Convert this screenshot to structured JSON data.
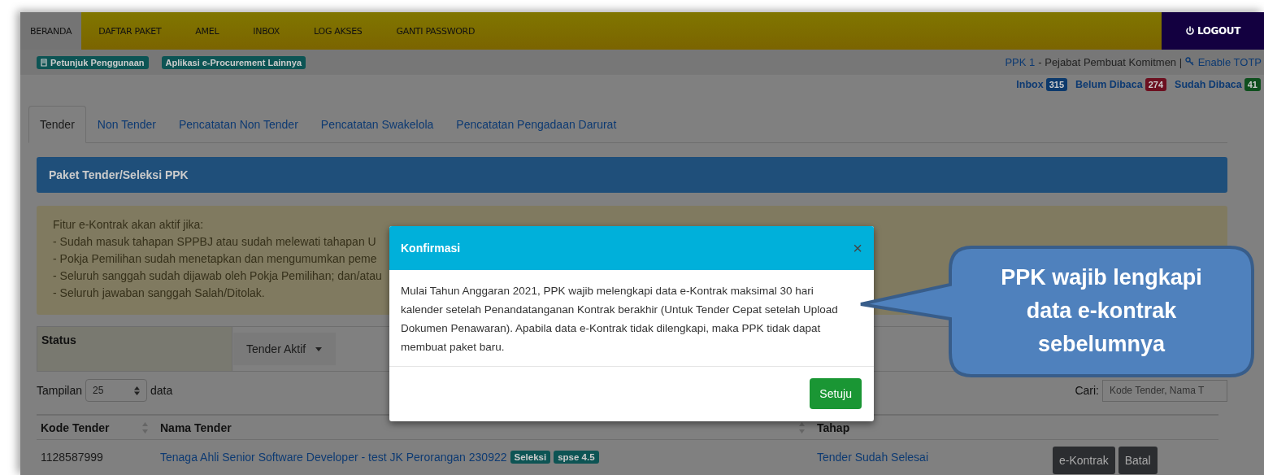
{
  "nav": {
    "items": [
      {
        "label": "BERANDA",
        "selected": true
      },
      {
        "label": "DAFTAR PAKET",
        "selected": false
      },
      {
        "label": "AMEL",
        "selected": false
      },
      {
        "label": "INBOX",
        "selected": false
      },
      {
        "label": "LOG AKSES",
        "selected": false
      },
      {
        "label": "GANTI PASSWORD",
        "selected": false
      }
    ],
    "logout": "LOGOUT"
  },
  "subbar": {
    "links": [
      "Petunjuk Penggunaan",
      "Aplikasi e-Procurement Lainnya"
    ],
    "user": {
      "name": "PPK 1",
      "role": "- Pejabat Pembuat Komitmen |",
      "totp": "Enable TOTP"
    },
    "counters": [
      {
        "label": "Inbox",
        "count": "315",
        "color": "#0d3a6c"
      },
      {
        "label": "Belum Dibaca",
        "count": "274",
        "color": "#6c1020"
      },
      {
        "label": "Sudah Dibaca",
        "count": "41",
        "color": "#0f4f1e"
      }
    ]
  },
  "tabs": [
    {
      "label": "Tender",
      "selected": true
    },
    {
      "label": "Non Tender",
      "selected": false
    },
    {
      "label": "Pencatatan Non Tender",
      "selected": false
    },
    {
      "label": "Pencatatan Swakelola",
      "selected": false
    },
    {
      "label": "Pencatatan Pengadaan Darurat",
      "selected": false
    }
  ],
  "panel": {
    "title": "Paket Tender/Seleksi PPK",
    "notice": [
      "Fitur e-Kontrak akan aktif jika:",
      "- Sudah masuk tahapan SPPBJ atau sudah melewati tahapan U",
      "- Pokja Pemilihan sudah menetapkan dan mengumumkan peme",
      "- Seluruh sanggah sudah dijawab oleh Pokja Pemilihan; dan/atau",
      "- Seluruh jawaban sanggah Salah/Ditolak."
    ],
    "status": {
      "label": "Status",
      "value": "Tender Aktif"
    },
    "page_size": {
      "label": "Tampilan",
      "value": "25",
      "suffix": "data"
    },
    "search": {
      "label": "Cari:",
      "placeholder": "Kode Tender, Nama T"
    },
    "table": {
      "columns": [
        {
          "label": "Kode Tender",
          "sortable": true
        },
        {
          "label": "Nama Tender",
          "sortable": true
        },
        {
          "label": "Tahap",
          "sortable": false
        }
      ],
      "rows": [
        {
          "code": "1128587999",
          "name": "Tenaga Ahli Senior Software Developer - test JK Perorangan 230922",
          "tags": [
            "Seleksi",
            "spse 4.5"
          ],
          "stage": "Tender Sudah Selesai",
          "actions": [
            "e-Kontrak",
            "Batal"
          ]
        }
      ]
    }
  },
  "modal": {
    "title": "Konfirmasi",
    "body": "Mulai Tahun Anggaran 2021, PPK wajib melengkapi data e-Kontrak maksimal 30 hari kalender setelah Penandatanganan Kontrak berakhir (Untuk Tender Cepat setelah Upload Dokumen Penawaran). Apabila data e-Kontrak tidak dilengkapi, maka PPK tidak dapat membuat paket baru.",
    "close": "×",
    "button": "Setuju"
  },
  "callout": {
    "text": "PPK wajib lengkapi data e-kontrak sebelumnya"
  }
}
